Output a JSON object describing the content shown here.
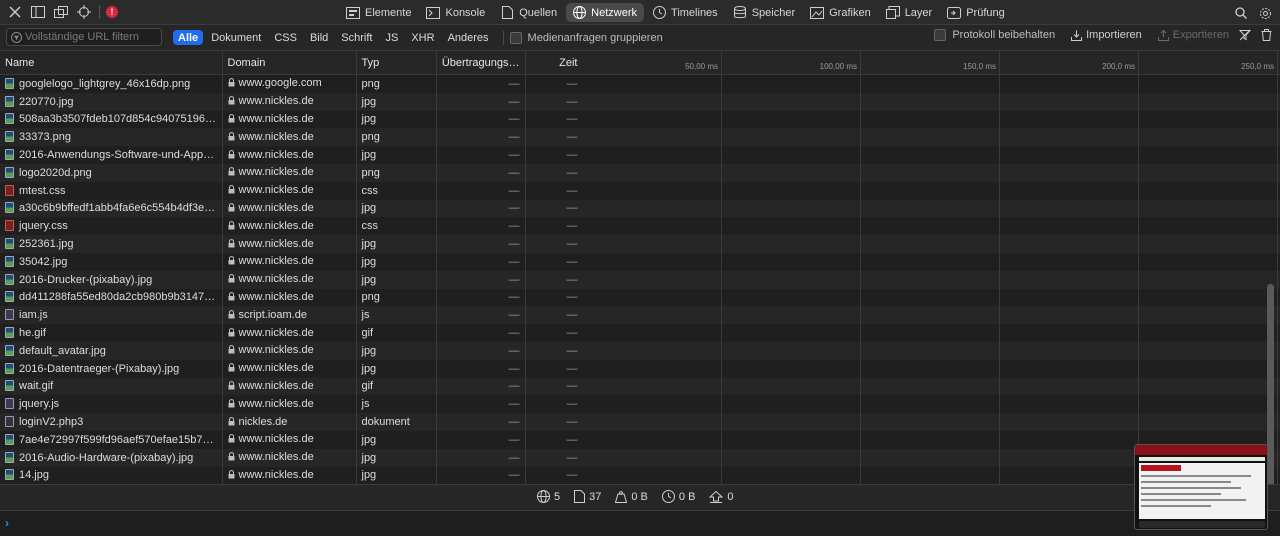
{
  "toolbar": {
    "tabs": [
      {
        "label": "Elemente",
        "icon": "elements-icon",
        "active": false
      },
      {
        "label": "Konsole",
        "icon": "console-icon",
        "active": false
      },
      {
        "label": "Quellen",
        "icon": "sources-icon",
        "active": false
      },
      {
        "label": "Netzwerk",
        "icon": "network-icon",
        "active": true
      },
      {
        "label": "Timelines",
        "icon": "timelines-icon",
        "active": false
      },
      {
        "label": "Speicher",
        "icon": "storage-icon",
        "active": false
      },
      {
        "label": "Grafiken",
        "icon": "graphics-icon",
        "active": false
      },
      {
        "label": "Layer",
        "icon": "layers-icon",
        "active": false
      },
      {
        "label": "Prüfung",
        "icon": "audit-icon",
        "active": false
      }
    ],
    "error_badge": "!"
  },
  "filter": {
    "placeholder": "Vollständige URL filtern",
    "types": [
      "Alle",
      "Dokument",
      "CSS",
      "Bild",
      "Schrift",
      "JS",
      "XHR",
      "Anderes"
    ],
    "active_type": "Alle",
    "group_media": "Medienanfragen gruppieren",
    "keep_log": "Protokoll beibehalten",
    "import": "Importieren",
    "export": "Exportieren"
  },
  "columns": {
    "name": "Name",
    "domain": "Domain",
    "type": "Typ",
    "transfer": "Übertragungs…",
    "time": "Zeit"
  },
  "timeline": {
    "ticks": [
      "50,00 ms",
      "100,00 ms",
      "150,0 ms",
      "200,0 ms",
      "250,0 ms"
    ]
  },
  "rows": [
    {
      "name": "googlelogo_lightgrey_46x16dp.png",
      "domain": "www.google.com",
      "type": "png",
      "transfer": "—",
      "time": "—",
      "icon": "img"
    },
    {
      "name": "220770.jpg",
      "domain": "www.nickles.de",
      "type": "jpg",
      "transfer": "—",
      "time": "—",
      "icon": "img"
    },
    {
      "name": "508aa3b3507fdeb107d854c94075196…",
      "domain": "www.nickles.de",
      "type": "jpg",
      "transfer": "—",
      "time": "—",
      "icon": "img"
    },
    {
      "name": "33373.png",
      "domain": "www.nickles.de",
      "type": "png",
      "transfer": "—",
      "time": "—",
      "icon": "img"
    },
    {
      "name": "2016-Anwendungs-Software-und-Apps…",
      "domain": "www.nickles.de",
      "type": "jpg",
      "transfer": "—",
      "time": "—",
      "icon": "img"
    },
    {
      "name": "logo2020d.png",
      "domain": "www.nickles.de",
      "type": "png",
      "transfer": "—",
      "time": "—",
      "icon": "img"
    },
    {
      "name": "mtest.css",
      "domain": "www.nickles.de",
      "type": "css",
      "transfer": "—",
      "time": "—",
      "icon": "css"
    },
    {
      "name": "a30c6b9bffedf1abb4fa6e6c554b4df3e…",
      "domain": "www.nickles.de",
      "type": "jpg",
      "transfer": "—",
      "time": "—",
      "icon": "img"
    },
    {
      "name": "jquery.css",
      "domain": "www.nickles.de",
      "type": "css",
      "transfer": "—",
      "time": "—",
      "icon": "css"
    },
    {
      "name": "252361.jpg",
      "domain": "www.nickles.de",
      "type": "jpg",
      "transfer": "—",
      "time": "—",
      "icon": "img"
    },
    {
      "name": "35042.jpg",
      "domain": "www.nickles.de",
      "type": "jpg",
      "transfer": "—",
      "time": "—",
      "icon": "img"
    },
    {
      "name": "2016-Drucker-(pixabay).jpg",
      "domain": "www.nickles.de",
      "type": "jpg",
      "transfer": "—",
      "time": "—",
      "icon": "img"
    },
    {
      "name": "dd411288fa55ed80da2cb980b9b3147…",
      "domain": "www.nickles.de",
      "type": "png",
      "transfer": "—",
      "time": "—",
      "icon": "img"
    },
    {
      "name": "iam.js",
      "domain": "script.ioam.de",
      "type": "js",
      "transfer": "—",
      "time": "—",
      "icon": "js"
    },
    {
      "name": "he.gif",
      "domain": "www.nickles.de",
      "type": "gif",
      "transfer": "—",
      "time": "—",
      "icon": "img"
    },
    {
      "name": "default_avatar.jpg",
      "domain": "www.nickles.de",
      "type": "jpg",
      "transfer": "—",
      "time": "—",
      "icon": "img"
    },
    {
      "name": "2016-Datentraeger-(Pixabay).jpg",
      "domain": "www.nickles.de",
      "type": "jpg",
      "transfer": "—",
      "time": "—",
      "icon": "img"
    },
    {
      "name": "wait.gif",
      "domain": "www.nickles.de",
      "type": "gif",
      "transfer": "—",
      "time": "—",
      "icon": "img"
    },
    {
      "name": "jquery.js",
      "domain": "www.nickles.de",
      "type": "js",
      "transfer": "—",
      "time": "—",
      "icon": "js"
    },
    {
      "name": "loginV2.php3",
      "domain": "nickles.de",
      "type": "dokument",
      "transfer": "—",
      "time": "—",
      "icon": "doc"
    },
    {
      "name": "7ae4e72997f599fd96aef570efae15b70…",
      "domain": "www.nickles.de",
      "type": "jpg",
      "transfer": "—",
      "time": "—",
      "icon": "img"
    },
    {
      "name": "2016-Audio-Hardware-(pixabay).jpg",
      "domain": "www.nickles.de",
      "type": "jpg",
      "transfer": "—",
      "time": "—",
      "icon": "img"
    },
    {
      "name": "14.jpg",
      "domain": "www.nickles.de",
      "type": "jpg",
      "transfer": "—",
      "time": "—",
      "icon": "img"
    }
  ],
  "footer": {
    "domains": "5",
    "resources": "37",
    "size": "0 B",
    "transferred": "0 B",
    "errors": "0"
  },
  "console": {
    "prompt": "›"
  }
}
